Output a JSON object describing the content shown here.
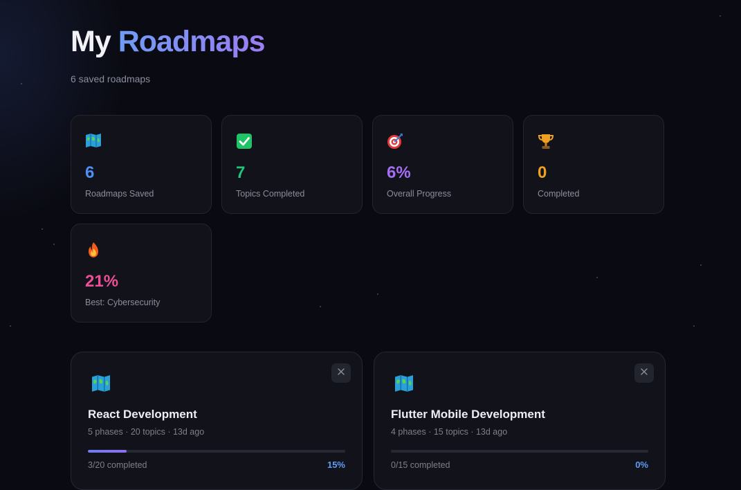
{
  "header": {
    "title_part1": "My",
    "title_part2": "Roadmaps",
    "subtitle": "6 saved roadmaps"
  },
  "stats": [
    {
      "icon": "map-icon",
      "value": "6",
      "label": "Roadmaps Saved",
      "color": "#4f8ef5"
    },
    {
      "icon": "checkmark-icon",
      "value": "7",
      "label": "Topics Completed",
      "color": "#20c47a"
    },
    {
      "icon": "target-icon",
      "value": "6%",
      "label": "Overall Progress",
      "color": "#a56ef5"
    },
    {
      "icon": "trophy-icon",
      "value": "0",
      "label": "Completed",
      "color": "#f0a020"
    },
    {
      "icon": "fire-icon",
      "value": "21%",
      "label": "Best: Cybersecurity",
      "color": "#ec4f95"
    }
  ],
  "roadmaps": [
    {
      "icon": "map-icon",
      "title": "React Development",
      "meta": "5 phases · 20 topics · 13d ago",
      "completed_text": "3/20 completed",
      "percent_label": "15%",
      "progress": 0.15
    },
    {
      "icon": "map-icon",
      "title": "Flutter Mobile Development",
      "meta": "4 phases · 15 topics · 13d ago",
      "completed_text": "0/15 completed",
      "percent_label": "0%",
      "progress": 0.0
    }
  ],
  "close_icon": "close-icon"
}
